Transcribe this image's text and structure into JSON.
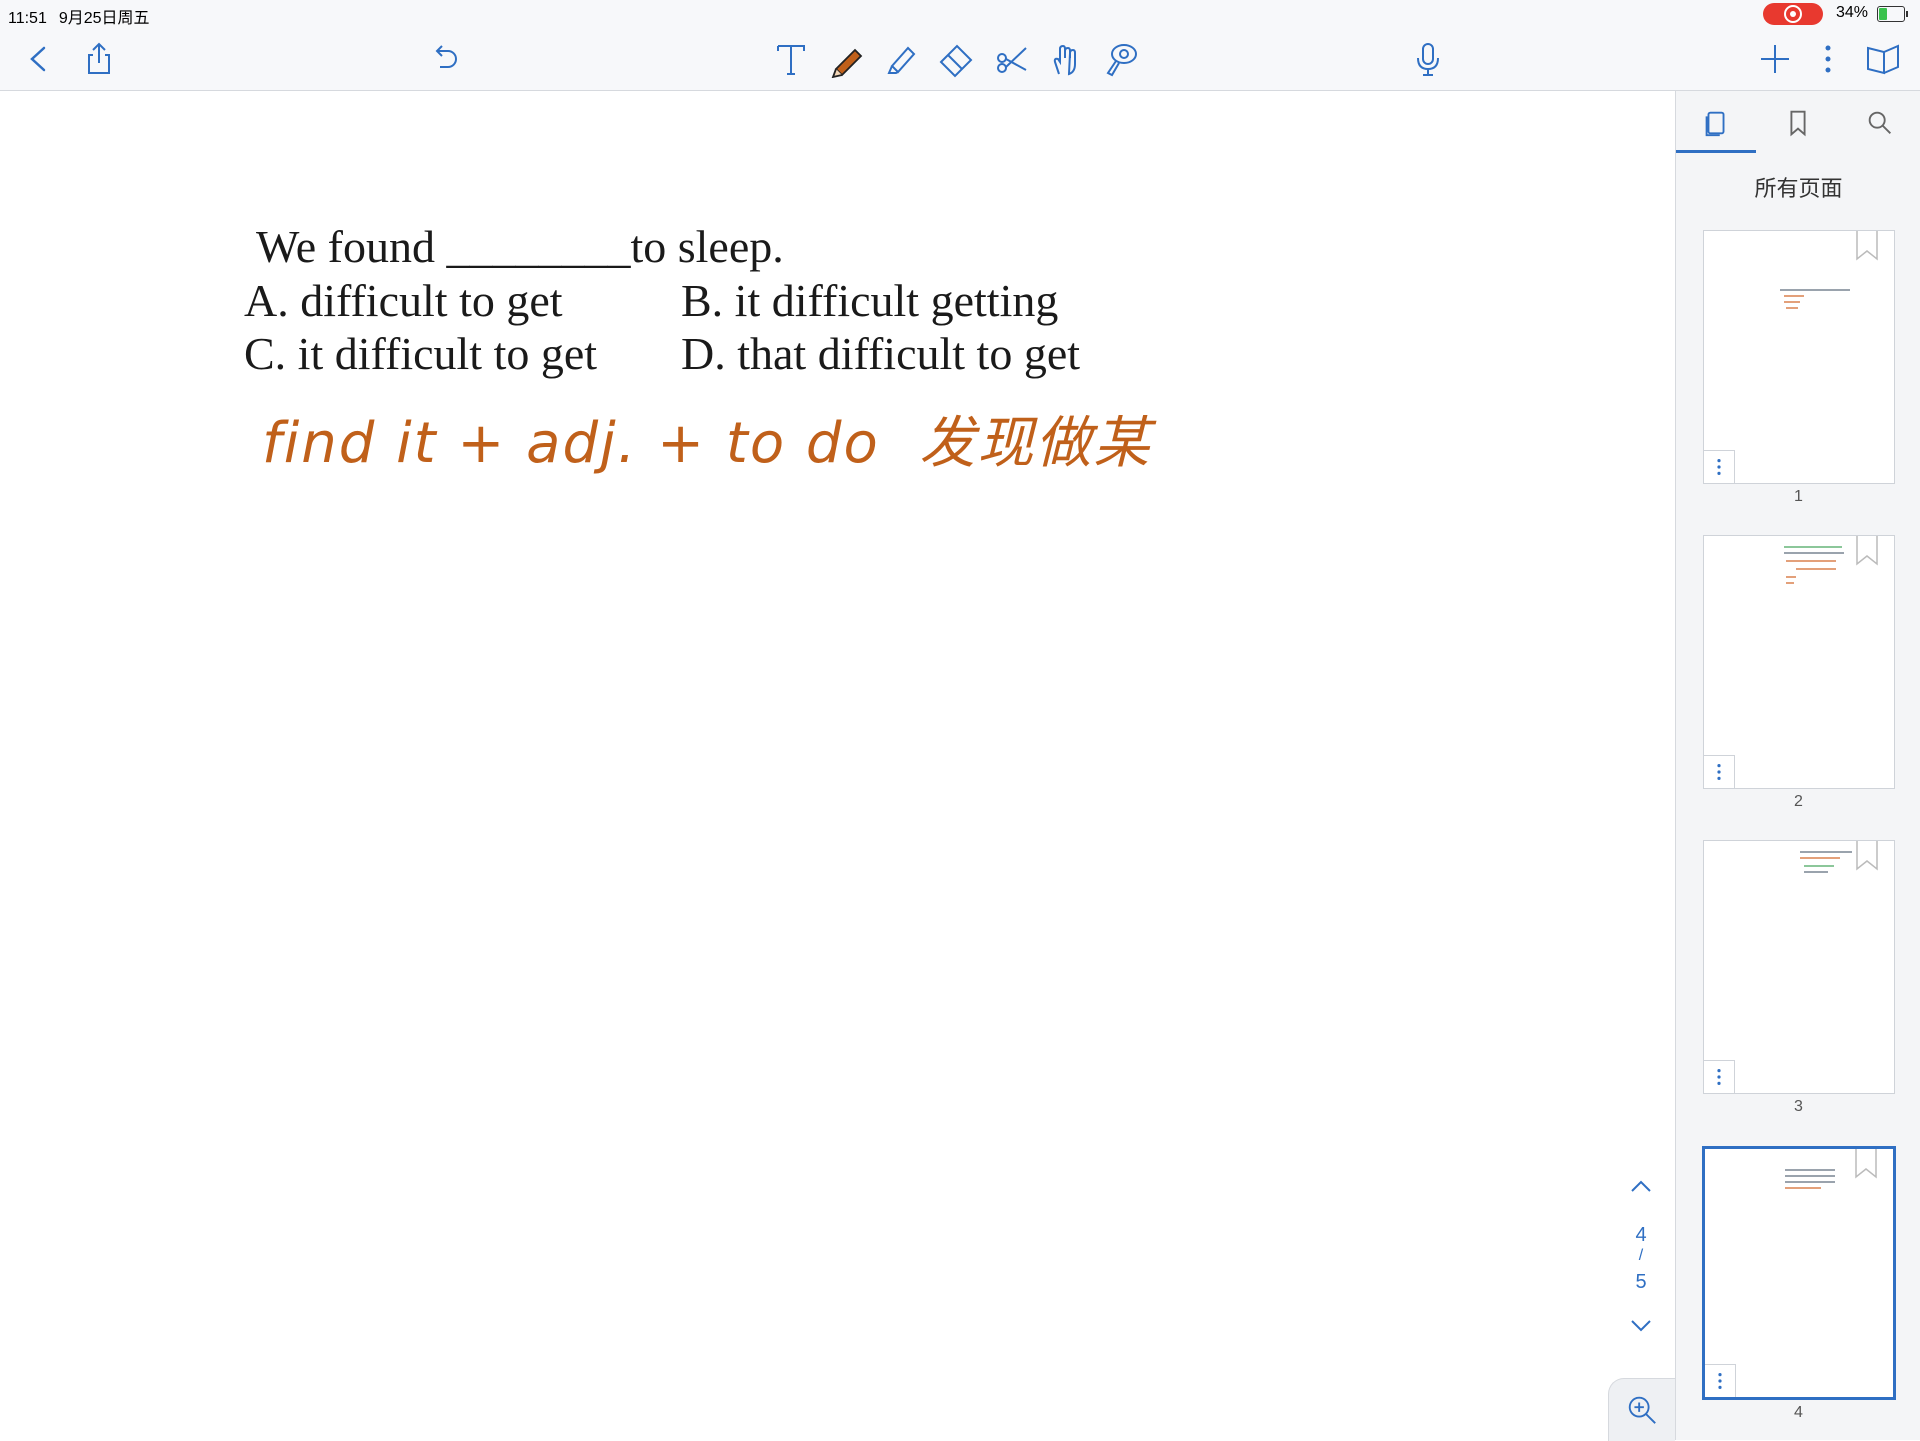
{
  "status": {
    "time": "11:51",
    "date": "9月25日周五",
    "battery": "34%",
    "battery_level": 0.34
  },
  "toolbar": {
    "icons": [
      "back-icon",
      "share-icon",
      "undo-icon",
      "text-tool-icon",
      "pencil-icon",
      "highlighter-icon",
      "eraser-icon",
      "scissors-icon",
      "hand-icon",
      "lasso-icon",
      "microphone-icon",
      "add-icon",
      "more-icon",
      "book-icon"
    ],
    "colors": {
      "accent": "#2f6fc3",
      "pencil": "#c0601a"
    }
  },
  "document": {
    "question": {
      "stem": "We found ________to sleep.",
      "option_a": "A. difficult to get",
      "option_b": "B. it difficult getting",
      "option_c": "C. it difficult to get",
      "option_d": "D. that difficult to get"
    },
    "annotation": "find it + adj. + to do  发现做某"
  },
  "sidebar": {
    "heading": "所有页面",
    "pages": [
      {
        "number": "1",
        "active": false
      },
      {
        "number": "2",
        "active": false
      },
      {
        "number": "3",
        "active": false
      },
      {
        "number": "4",
        "active": true
      }
    ]
  },
  "pager": {
    "current": "4",
    "separator": "/",
    "total": "5"
  }
}
